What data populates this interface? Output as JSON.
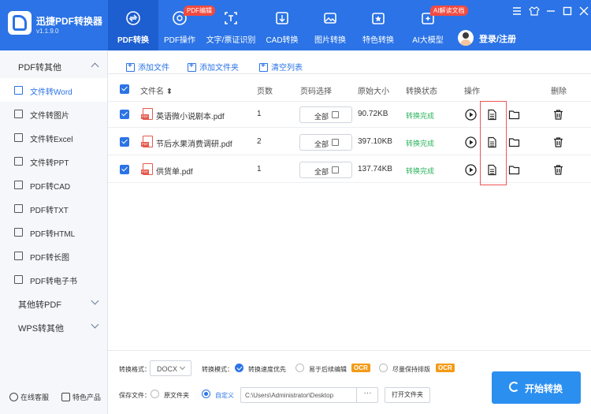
{
  "app": {
    "name": "迅捷PDF转换器",
    "version": "v1.1.9.0"
  },
  "nav": {
    "tabs": [
      {
        "label": "PDF转换",
        "badge": ""
      },
      {
        "label": "PDF操作",
        "badge": "PDF编辑"
      },
      {
        "label": "文字/票证识别",
        "badge": ""
      },
      {
        "label": "CAD转换",
        "badge": ""
      },
      {
        "label": "图片转换",
        "badge": ""
      },
      {
        "label": "特色转换",
        "badge": ""
      },
      {
        "label": "AI大模型",
        "badge": "AI解读文档"
      }
    ],
    "login_label": "登录/注册"
  },
  "sidebar": {
    "group1": "PDF转其他",
    "items": [
      {
        "label": "文件转Word",
        "icon": "word-icon"
      },
      {
        "label": "文件转图片",
        "icon": "image-icon"
      },
      {
        "label": "文件转Excel",
        "icon": "excel-icon"
      },
      {
        "label": "文件转PPT",
        "icon": "ppt-icon"
      },
      {
        "label": "PDF转CAD",
        "icon": "cad-icon"
      },
      {
        "label": "PDF转TXT",
        "icon": "txt-icon"
      },
      {
        "label": "PDF转HTML",
        "icon": "html-icon"
      },
      {
        "label": "PDF转长图",
        "icon": "long-image-icon"
      },
      {
        "label": "PDF转电子书",
        "icon": "ebook-icon"
      }
    ],
    "group2": "其他转PDF",
    "group3": "WPS转其他",
    "footer": {
      "service": "在线客服",
      "featured": "特色产品"
    }
  },
  "toolbar": {
    "add_file": "添加文件",
    "add_folder": "添加文件夹",
    "clear_list": "清空列表"
  },
  "table": {
    "headers": {
      "filename": "文件名 ⬍",
      "pages": "页数",
      "page_select": "页码选择",
      "size": "原始大小",
      "status": "转换状态",
      "ops": "操作",
      "delete": "删除"
    },
    "rows": [
      {
        "name": "英语微小说剧本.pdf",
        "pages": "1",
        "page_btn": "全部",
        "size": "90.72KB",
        "status": "转换完成"
      },
      {
        "name": "节后水果消费调研.pdf",
        "pages": "2",
        "page_btn": "全部",
        "size": "397.10KB",
        "status": "转换完成"
      },
      {
        "name": "供货单.pdf",
        "pages": "1",
        "page_btn": "全部",
        "size": "137.74KB",
        "status": "转换完成"
      }
    ]
  },
  "bottom": {
    "format_label": "转换格式：",
    "format_value": "DOCX",
    "mode_label": "转换模式：",
    "mode_speed": "转换速度优先",
    "mode_edit": "易于后续编辑",
    "mode_layout": "尽量保持排版",
    "ocr": "OCR",
    "save_label": "保存文件：",
    "save_source": "原文件夹",
    "save_custom": "自定义",
    "path": "C:\\Users\\Administrator\\Desktop",
    "browse": "···",
    "open_folder": "打开文件夹",
    "start": "开始转换"
  },
  "colors": {
    "brand": "#2b73e6",
    "status_ok": "#29b35a",
    "ocr_badge": "#f39b16",
    "highlight": "#e55555"
  }
}
